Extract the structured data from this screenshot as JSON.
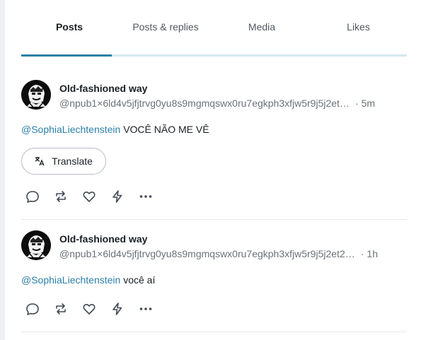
{
  "tabs": [
    {
      "label": "Posts",
      "active": true
    },
    {
      "label": "Posts & replies",
      "active": false
    },
    {
      "label": "Media",
      "active": false
    },
    {
      "label": "Likes",
      "active": false
    }
  ],
  "colors": {
    "accent": "#2b7fa8",
    "text": "#1a1f24",
    "muted": "#6b7178",
    "divider": "#e6e8ea"
  },
  "posts": [
    {
      "author": "Old-fashioned way",
      "handle": "@npub1×6ld4v5jfjtrvg0yu8s9mgmqswx0ru7egkph3xfjw5r9j5j2et…",
      "time": "5m",
      "mention": "@SophiaLiechtenstein",
      "text": " VOCÊ NÃO ME VÊ",
      "translate_label": "Translate"
    },
    {
      "author": "Old-fashioned way",
      "handle": "@npub1×6ld4v5jfjtrvg0yu8s9mgmqswx0ru7egkph3xfjw5r9j5j2et2…",
      "time": "1h",
      "mention": "@SophiaLiechtenstein",
      "text": " você aí"
    }
  ],
  "action_icons": [
    "reply-icon",
    "repost-icon",
    "like-icon",
    "zap-icon",
    "more-icon"
  ]
}
